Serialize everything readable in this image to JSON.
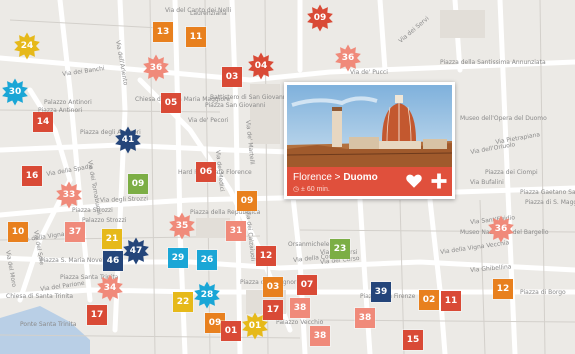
{
  "colors": {
    "red": "#d94a36",
    "salmon": "#f08a7a",
    "orange": "#e8801e",
    "green": "#7cae45",
    "cyan": "#1aa6d6",
    "navy": "#24457a",
    "yellow": "#e6b91a",
    "water": "#b9cfe6",
    "popup_bar": "#e0503c"
  },
  "popup": {
    "breadcrumb_city": "Florence",
    "breadcrumb_separator": " > ",
    "place": "Duomo",
    "duration": "◷ ± 60 min.",
    "favorite_icon": "heart-icon",
    "add_icon": "plus-icon"
  },
  "street_labels": [
    {
      "id": "laurenziana",
      "text": "Laurenziana"
    },
    {
      "id": "via-banchi",
      "text": "Via dei Banchi"
    },
    {
      "id": "piazza-antinori",
      "text": "Piazza Antinori"
    },
    {
      "id": "palazzo-antinori",
      "text": "Palazzo Antinori"
    },
    {
      "id": "piazza-degli-antinori",
      "text": "Piazza degli Antinori"
    },
    {
      "id": "via-tornabuoni",
      "text": "Via dei Tornabuoni"
    },
    {
      "id": "via-strozzi",
      "text": "Via degli Strozzi"
    },
    {
      "id": "palazzo-strozzi",
      "text": "Palazzo Strozzi"
    },
    {
      "id": "piazza-strozzi",
      "text": "Piazza Strozzi"
    },
    {
      "id": "via-vigna",
      "text": "Via della Vigna Nuova"
    },
    {
      "id": "via-spada",
      "text": "Via della Spada"
    },
    {
      "id": "via-parione",
      "text": "Via del Parione"
    },
    {
      "id": "piazza-santa-trinita",
      "text": "Piazza Santa Trinita"
    },
    {
      "id": "chiesa-santa-trinita",
      "text": "Chiesa di Santa Trinita"
    },
    {
      "id": "ponte-santa-trinita",
      "text": "Ponte Santa Trinita"
    },
    {
      "id": "piazza-repubblica",
      "text": "Piazza della Repubblica"
    },
    {
      "id": "hard-rock",
      "text": "Hard Rock Cafe Florence"
    },
    {
      "id": "via-pecori",
      "text": "Via de' Pecori"
    },
    {
      "id": "battistero",
      "text": "Battistero di San Giovanni"
    },
    {
      "id": "santa-maria-maggiore",
      "text": "Chiesa di Santa Maria Maggiore"
    },
    {
      "id": "via-calzaiuoli",
      "text": "Via dei Calzaiuoli"
    },
    {
      "id": "piazza-san-firenze",
      "text": "Piazza San Firenze"
    },
    {
      "id": "orsanmichele",
      "text": "Orsanmichele"
    },
    {
      "id": "via-condotta",
      "text": "Via della Condotta"
    },
    {
      "id": "via-ghibellina",
      "text": "Via Ghibellina"
    },
    {
      "id": "piazza-santissima",
      "text": "Piazza della Santissima Annunziata"
    },
    {
      "id": "museo-opera",
      "text": "Museo dell'Opera del Duomo"
    },
    {
      "id": "piazza-magg",
      "text": "Piazza di S. Maggiore"
    },
    {
      "id": "via-pucci",
      "text": "Via de' Pucci"
    },
    {
      "id": "via-servi",
      "text": "Via dei Servi"
    },
    {
      "id": "via-oriuolo",
      "text": "Via dell'Oriuolo"
    },
    {
      "id": "via-vigna-vecchia",
      "text": "Via della Vigna Vecchia"
    },
    {
      "id": "via-corso",
      "text": "Via del Corso"
    },
    {
      "id": "piazza-signoria",
      "text": "Piazza della Signoria"
    },
    {
      "id": "palazzo-vecchio",
      "text": "Palazzo Vecchio"
    },
    {
      "id": "museo-bargello",
      "text": "Museo Nazionale del Bargello"
    },
    {
      "id": "piazza-salvemini",
      "text": "Piazza Gaetano Salvemini"
    },
    {
      "id": "piazza-ciompi",
      "text": "Piazza dei Ciompi"
    },
    {
      "id": "via-pietrapiana",
      "text": "Via Pietrapiana"
    },
    {
      "id": "via-sant-egidio",
      "text": "Via Sant'Egidio"
    },
    {
      "id": "via-corsi",
      "text": "Via del Corsi"
    },
    {
      "id": "piazza-san-giovanni",
      "text": "Piazza San Giovanni"
    },
    {
      "id": "via-martelli",
      "text": "Via de' Martelli"
    },
    {
      "id": "via-medici",
      "text": "Via de' Medici"
    },
    {
      "id": "via-sole",
      "text": "Via del Sole"
    },
    {
      "id": "via-ariento",
      "text": "Via dell'Ariento"
    },
    {
      "id": "via-bufalini",
      "text": "Via Bufalini"
    },
    {
      "id": "via-canto",
      "text": "Via del Canto dei Nelli"
    },
    {
      "id": "piazza-borgo",
      "text": "Piazza di Borgo"
    },
    {
      "id": "via-del-moro",
      "text": "Via del Moro"
    },
    {
      "id": "piazza-ciz",
      "text": "Piazza S. Maria Novella"
    }
  ],
  "markers": [
    {
      "id": "m13",
      "label": "13",
      "shape": "square",
      "color": "orange"
    },
    {
      "id": "m11",
      "label": "11",
      "shape": "square",
      "color": "orange"
    },
    {
      "id": "m09a",
      "label": "09",
      "shape": "star",
      "color": "red"
    },
    {
      "id": "m24",
      "label": "24",
      "shape": "star",
      "color": "yellow"
    },
    {
      "id": "m36a",
      "label": "36",
      "shape": "star",
      "color": "salmon"
    },
    {
      "id": "m03a",
      "label": "03",
      "shape": "square",
      "color": "red"
    },
    {
      "id": "m04",
      "label": "04",
      "shape": "star",
      "color": "red"
    },
    {
      "id": "m36b",
      "label": "36",
      "shape": "star",
      "color": "salmon"
    },
    {
      "id": "m30",
      "label": "30",
      "shape": "star",
      "color": "cyan"
    },
    {
      "id": "m05",
      "label": "05",
      "shape": "square",
      "color": "red"
    },
    {
      "id": "m14",
      "label": "14",
      "shape": "square",
      "color": "red"
    },
    {
      "id": "m41",
      "label": "41",
      "shape": "star",
      "color": "navy"
    },
    {
      "id": "m16",
      "label": "16",
      "shape": "square",
      "color": "red"
    },
    {
      "id": "m06",
      "label": "06",
      "shape": "square",
      "color": "red"
    },
    {
      "id": "m09b",
      "label": "09",
      "shape": "square",
      "color": "green"
    },
    {
      "id": "m33",
      "label": "33",
      "shape": "star",
      "color": "salmon"
    },
    {
      "id": "m09c",
      "label": "09",
      "shape": "square",
      "color": "orange"
    },
    {
      "id": "m10",
      "label": "10",
      "shape": "square",
      "color": "orange"
    },
    {
      "id": "m37",
      "label": "37",
      "shape": "square",
      "color": "salmon"
    },
    {
      "id": "m21",
      "label": "21",
      "shape": "square",
      "color": "yellow"
    },
    {
      "id": "m35",
      "label": "35",
      "shape": "star",
      "color": "salmon"
    },
    {
      "id": "m31",
      "label": "31",
      "shape": "square",
      "color": "salmon"
    },
    {
      "id": "m36c",
      "label": "36",
      "shape": "star",
      "color": "salmon"
    },
    {
      "id": "m46",
      "label": "46",
      "shape": "square",
      "color": "navy"
    },
    {
      "id": "m47",
      "label": "47",
      "shape": "star",
      "color": "navy"
    },
    {
      "id": "m29",
      "label": "29",
      "shape": "square",
      "color": "cyan"
    },
    {
      "id": "m26",
      "label": "26",
      "shape": "square",
      "color": "cyan"
    },
    {
      "id": "m12a",
      "label": "12",
      "shape": "square",
      "color": "red"
    },
    {
      "id": "m23",
      "label": "23",
      "shape": "square",
      "color": "green"
    },
    {
      "id": "m34",
      "label": "34",
      "shape": "star",
      "color": "salmon"
    },
    {
      "id": "m03b",
      "label": "03",
      "shape": "square",
      "color": "orange"
    },
    {
      "id": "m07",
      "label": "07",
      "shape": "square",
      "color": "red"
    },
    {
      "id": "m39",
      "label": "39",
      "shape": "square",
      "color": "navy"
    },
    {
      "id": "m12b",
      "label": "12",
      "shape": "square",
      "color": "orange"
    },
    {
      "id": "m22",
      "label": "22",
      "shape": "square",
      "color": "yellow"
    },
    {
      "id": "m28",
      "label": "28",
      "shape": "star",
      "color": "cyan"
    },
    {
      "id": "m17a",
      "label": "17",
      "shape": "square",
      "color": "red"
    },
    {
      "id": "m17b",
      "label": "17",
      "shape": "square",
      "color": "red"
    },
    {
      "id": "m38a",
      "label": "38",
      "shape": "square",
      "color": "salmon"
    },
    {
      "id": "m02",
      "label": "02",
      "shape": "square",
      "color": "orange"
    },
    {
      "id": "m11b",
      "label": "11",
      "shape": "square",
      "color": "red"
    },
    {
      "id": "m09d",
      "label": "09",
      "shape": "square",
      "color": "orange"
    },
    {
      "id": "m38b",
      "label": "38",
      "shape": "square",
      "color": "salmon"
    },
    {
      "id": "m01a",
      "label": "01",
      "shape": "square",
      "color": "red"
    },
    {
      "id": "m01b",
      "label": "01",
      "shape": "star",
      "color": "yellow"
    },
    {
      "id": "m38c",
      "label": "38",
      "shape": "square",
      "color": "salmon"
    },
    {
      "id": "m15",
      "label": "15",
      "shape": "square",
      "color": "red"
    }
  ]
}
